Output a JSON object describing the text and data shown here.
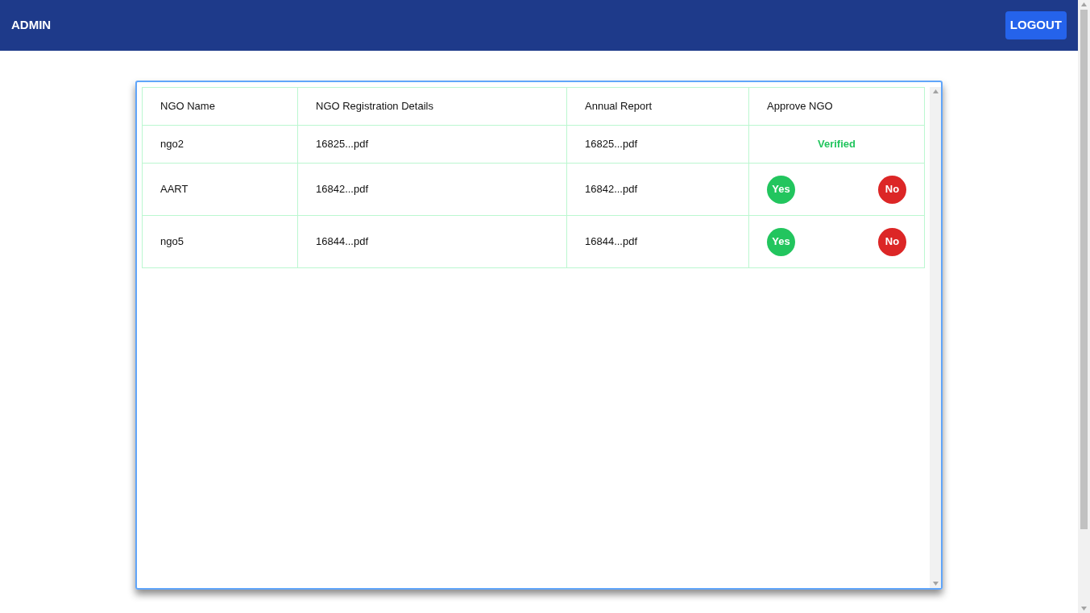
{
  "header": {
    "title": "ADMIN",
    "logout": "LOGOUT"
  },
  "table": {
    "columns": [
      "NGO Name",
      "NGO Registration Details",
      "Annual Report",
      "Approve NGO"
    ],
    "rows": [
      {
        "name": "ngo2",
        "registration": "16825...pdf",
        "report": "16825...pdf",
        "approval": {
          "kind": "verified",
          "text": "Verified"
        }
      },
      {
        "name": "AART",
        "registration": "16842...pdf",
        "report": "16842...pdf",
        "approval": {
          "kind": "buttons",
          "yes": "Yes",
          "no": "No"
        }
      },
      {
        "name": "ngo5",
        "registration": "16844...pdf",
        "report": "16844...pdf",
        "approval": {
          "kind": "buttons",
          "yes": "Yes",
          "no": "No"
        }
      }
    ]
  }
}
